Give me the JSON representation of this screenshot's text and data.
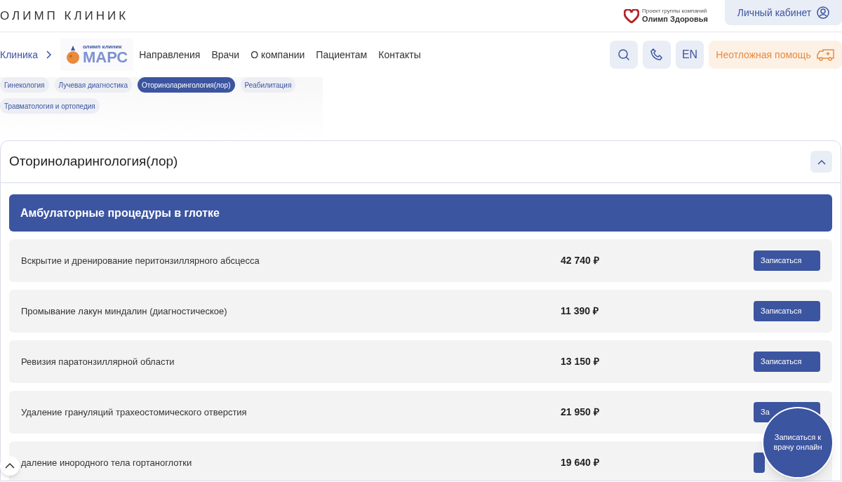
{
  "top_bar": {
    "brand": "ОЛИМП КЛИНИК",
    "group_caption": "Проект группы компаний",
    "group_name": "Олимп Здоровья",
    "account_button": "Личный кабинет"
  },
  "nav": {
    "breadcrumb": "Клиника",
    "logo_small": "олимп клиник",
    "logo_big": "МАРС",
    "links": [
      "Направления",
      "Врачи",
      "О компании",
      "Пациентам",
      "Контакты"
    ],
    "lang_button": "EN",
    "emergency_button": "Неотложная помощь"
  },
  "chips": [
    {
      "label": "Гинекология",
      "selected": false
    },
    {
      "label": "Лучевая диагностика",
      "selected": false
    },
    {
      "label": "Оториноларингология(лор)",
      "selected": true
    },
    {
      "label": "Реабилитация",
      "selected": false
    },
    {
      "label": "Травматология и ортопедия",
      "selected": false
    }
  ],
  "section": {
    "title": "Оториноларингология(лор)",
    "expanded": true,
    "group_title": "Амбулаторные процедуры в глотке",
    "rows": [
      {
        "name": "Вскрытие и дренирование перитонзиллярного абсцесса",
        "price": "42 740 ₽",
        "button": "Записаться"
      },
      {
        "name": "Промывание лакун миндалин (диагностическое)",
        "price": "11 390 ₽",
        "button": "Записаться"
      },
      {
        "name": "Ревизия паратонзиллярной области",
        "price": "13 150 ₽",
        "button": "Записаться"
      },
      {
        "name": "Удаление грануляций трахеостомического отверстия",
        "price": "21 950 ₽",
        "button": "За"
      },
      {
        "name": "даление инородного тела гортаноглотки",
        "price": "19 640 ₽"
      }
    ]
  },
  "floating_button": "Записаться к врачу онлайн"
}
